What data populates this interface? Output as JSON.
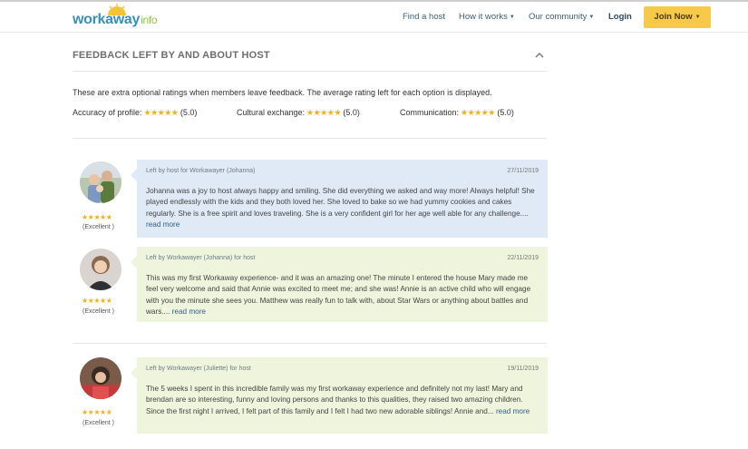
{
  "header": {
    "logo_text": "workaway",
    "logo_suffix": "info",
    "nav": [
      {
        "label": "Find a host",
        "dropdown": false
      },
      {
        "label": "How it works",
        "dropdown": true
      },
      {
        "label": "Our community",
        "dropdown": true
      },
      {
        "label": "Login",
        "dropdown": false
      }
    ],
    "join_label": "Join Now"
  },
  "section": {
    "title": "FEEDBACK LEFT BY AND ABOUT HOST",
    "intro": "These are extra optional ratings when members leave feedback. The average rating left for each option is displayed.",
    "ratings": [
      {
        "label": "Accuracy of profile:",
        "stars": "★★★★★",
        "value": "(5.0)"
      },
      {
        "label": "Cultural exchange:",
        "stars": "★★★★★",
        "value": "(5.0)"
      },
      {
        "label": "Communication:",
        "stars": "★★★★★",
        "value": "(5.0)"
      }
    ]
  },
  "reviews": [
    {
      "by": "Left by host for Workawayer (Johanna)",
      "date": "27/11/2019",
      "text": "Johanna was a joy to host always happy and smiling. She did everything we asked and way more! Always helpful! She played endlessly with the kids and they both loved her. She loved to bake so we had yummy cookies and cakes regularly. She is a free spirit and loves traveling. She is a very confident girl for her age well able for any challenge....",
      "read_more": "read more",
      "stars": "★★★★★",
      "rating_label": "(Excellent )"
    },
    {
      "by": "Left by Workawayer (Johanna) for host",
      "date": "22/11/2019",
      "text": "This was my first Workaway experience- and it was an amazing one! The minute I entered the house Mary made me feel very welcome and said that Annie was excited to meet me; and she was! Annie is an active child who will engage with you the minute she sees you. Matthew was really fun to talk with, about Star Wars or anything about battles and wars....",
      "read_more": "read more",
      "stars": "★★★★★",
      "rating_label": "(Excellent )"
    },
    {
      "by": "Left by Workawayer (Juliette) for host",
      "date": "19/11/2019",
      "text": "The 5 weeks I spent in this incredible family was my first workaway experience and definitely not my last! Mary and brendan are so interesting, funny and loving persons and thanks to this qualities, they raised two amazing children. Since the first night I arrived, I felt part of this family and I felt I had two new adorable siblings! Annie and...",
      "read_more": "read more",
      "stars": "★★★★★",
      "rating_label": "(Excellent )"
    }
  ],
  "colors": {
    "accent_yellow": "#f7c94b",
    "star": "#f2b01e",
    "bubble_blue": "#dfeaf6",
    "bubble_green": "#eef5dc",
    "link": "#2f5f8a"
  }
}
